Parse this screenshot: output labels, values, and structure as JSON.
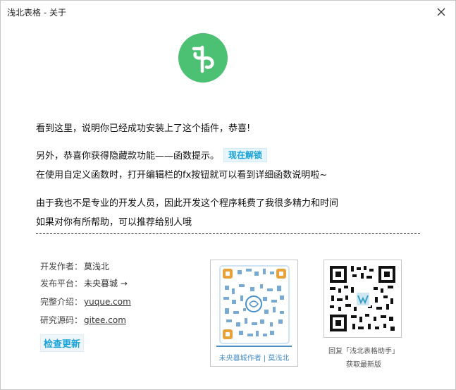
{
  "window": {
    "title": "浅北表格 - 关于",
    "close_icon": "close-icon"
  },
  "logo": {
    "icon": "qb-logo-icon",
    "color": "#4cc173"
  },
  "message": {
    "line1": "看到这里，说明你已经成功安装上了这个插件，恭喜!",
    "line2": "另外，恭喜你获得隐藏款功能——函数提示。",
    "unlock_label": "现在解锁",
    "line3": "在使用自定义函数时，打开编辑栏的fx按钮就可以看到详细函数说明啦~",
    "line4": "由于我也不是专业的开发人员，因此开发这个程序耗费了我很多精力和时间",
    "line5": "如果对你有所帮助，可以推荐给别人哦"
  },
  "info": {
    "author_label": "开发作者：",
    "author_value": "莫浅北",
    "platform_label": "发布平台：",
    "platform_value": "未央暮城 →",
    "intro_label": "完整介绍：",
    "intro_link": "yuque.com",
    "source_label": "研究源码：",
    "source_link": "gitee.com",
    "check_update_label": "检查更新"
  },
  "qr_left": {
    "caption": "未央暮城作者 | 莫浅北",
    "accent": "#4a90c8"
  },
  "qr_right": {
    "caption_line1": "回复「浅北表格助手」",
    "caption_line2": "获取最新版",
    "accent": "#3aa0c8"
  }
}
